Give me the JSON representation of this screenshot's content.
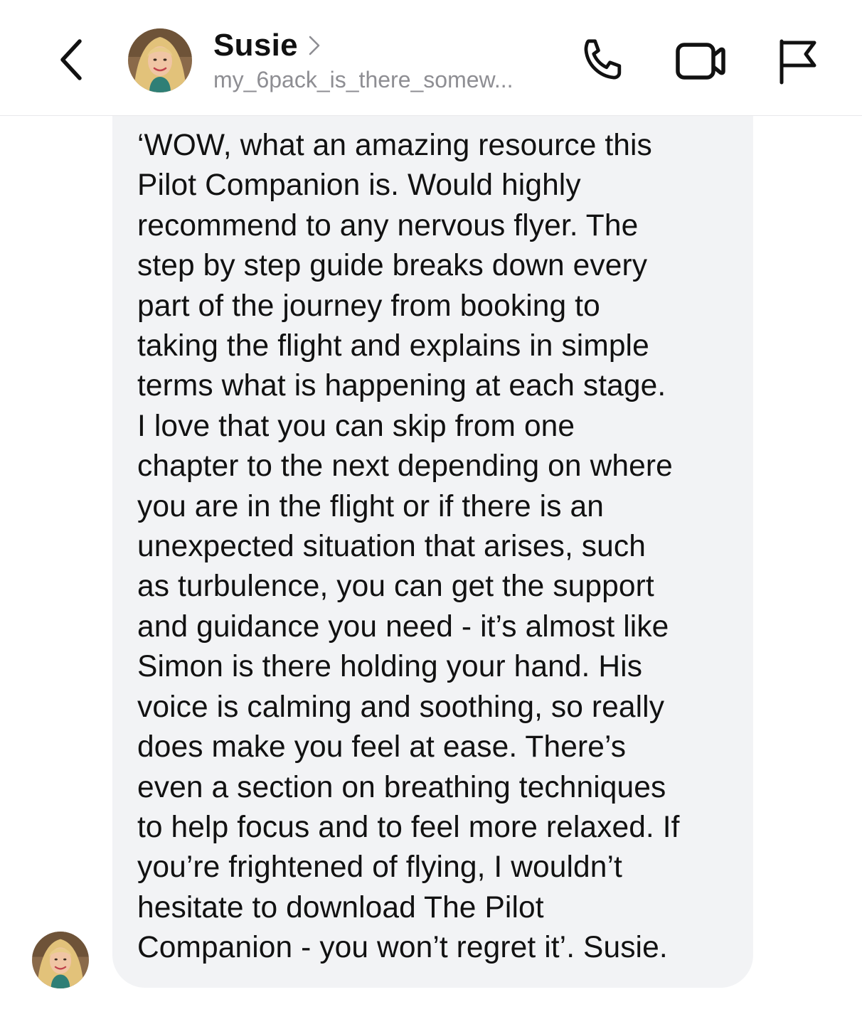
{
  "header": {
    "back_icon": "chevron-left-icon",
    "contact_name": "Susie",
    "contact_handle": "my_6pack_is_there_somew...",
    "actions": [
      {
        "name": "phone-call",
        "icon": "phone-icon"
      },
      {
        "name": "video-call",
        "icon": "video-camera-icon"
      },
      {
        "name": "report",
        "icon": "flag-icon"
      }
    ]
  },
  "message": {
    "sender": "Susie",
    "lines": [
      "‘WOW, what an amazing resource this",
      "Pilot Companion is. Would highly",
      "recommend to any nervous flyer. The",
      "step by step guide breaks down every",
      "part of the journey from booking to",
      "taking the flight and explains in simple",
      "terms what is happening at each stage.",
      "I love that you can skip from one",
      "chapter to the next depending on where",
      "you are in the flight or if there is an",
      "unexpected situation that arises, such",
      "as turbulence, you can get the support",
      "and guidance you need - it’s almost like",
      "Simon is there holding your hand. His",
      "voice is calming and soothing, so really",
      "does make you feel at ease. There’s",
      "even a section on breathing techniques",
      "to help focus and to feel more relaxed. If",
      "you’re frightened of flying, I wouldn’t",
      "hesitate to download The Pilot",
      "Companion - you won’t regret it’. Susie."
    ]
  },
  "colors": {
    "bubble_bg": "#f2f3f5",
    "text": "#111111",
    "secondary_text": "#8e8e93",
    "header_divider": "#e9e9eb"
  }
}
